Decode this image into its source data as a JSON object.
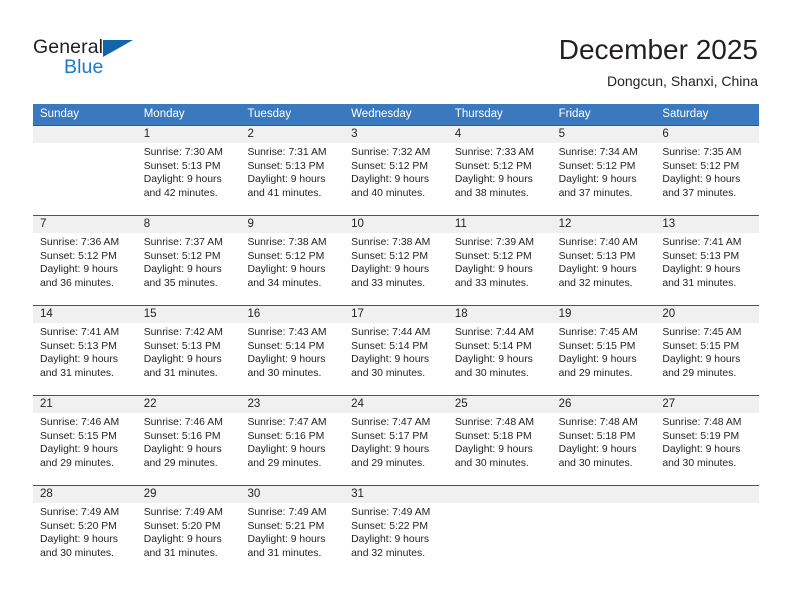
{
  "brand": {
    "name_top": "General",
    "name_bottom": "Blue",
    "accent_color": "#1c7ac6",
    "triangle_color": "#1464aa"
  },
  "header": {
    "title": "December 2025",
    "subtitle": "Dongcun, Shanxi, China"
  },
  "theme": {
    "header_row_bg": "#3a79bd",
    "header_row_text": "#ffffff",
    "week_separator": "#1f5fa0",
    "daynum_band_bg": "#f0f0f0",
    "text_color": "#231f20"
  },
  "weekdays": [
    "Sunday",
    "Monday",
    "Tuesday",
    "Wednesday",
    "Thursday",
    "Friday",
    "Saturday"
  ],
  "weeks": [
    {
      "days": [
        {
          "num": "",
          "sunrise": "",
          "sunset": "",
          "daylight_1": "",
          "daylight_2": "",
          "empty": true
        },
        {
          "num": "1",
          "sunrise": "Sunrise: 7:30 AM",
          "sunset": "Sunset: 5:13 PM",
          "daylight_1": "Daylight: 9 hours",
          "daylight_2": "and 42 minutes."
        },
        {
          "num": "2",
          "sunrise": "Sunrise: 7:31 AM",
          "sunset": "Sunset: 5:13 PM",
          "daylight_1": "Daylight: 9 hours",
          "daylight_2": "and 41 minutes."
        },
        {
          "num": "3",
          "sunrise": "Sunrise: 7:32 AM",
          "sunset": "Sunset: 5:12 PM",
          "daylight_1": "Daylight: 9 hours",
          "daylight_2": "and 40 minutes."
        },
        {
          "num": "4",
          "sunrise": "Sunrise: 7:33 AM",
          "sunset": "Sunset: 5:12 PM",
          "daylight_1": "Daylight: 9 hours",
          "daylight_2": "and 38 minutes."
        },
        {
          "num": "5",
          "sunrise": "Sunrise: 7:34 AM",
          "sunset": "Sunset: 5:12 PM",
          "daylight_1": "Daylight: 9 hours",
          "daylight_2": "and 37 minutes."
        },
        {
          "num": "6",
          "sunrise": "Sunrise: 7:35 AM",
          "sunset": "Sunset: 5:12 PM",
          "daylight_1": "Daylight: 9 hours",
          "daylight_2": "and 37 minutes."
        }
      ]
    },
    {
      "days": [
        {
          "num": "7",
          "sunrise": "Sunrise: 7:36 AM",
          "sunset": "Sunset: 5:12 PM",
          "daylight_1": "Daylight: 9 hours",
          "daylight_2": "and 36 minutes."
        },
        {
          "num": "8",
          "sunrise": "Sunrise: 7:37 AM",
          "sunset": "Sunset: 5:12 PM",
          "daylight_1": "Daylight: 9 hours",
          "daylight_2": "and 35 minutes."
        },
        {
          "num": "9",
          "sunrise": "Sunrise: 7:38 AM",
          "sunset": "Sunset: 5:12 PM",
          "daylight_1": "Daylight: 9 hours",
          "daylight_2": "and 34 minutes."
        },
        {
          "num": "10",
          "sunrise": "Sunrise: 7:38 AM",
          "sunset": "Sunset: 5:12 PM",
          "daylight_1": "Daylight: 9 hours",
          "daylight_2": "and 33 minutes."
        },
        {
          "num": "11",
          "sunrise": "Sunrise: 7:39 AM",
          "sunset": "Sunset: 5:12 PM",
          "daylight_1": "Daylight: 9 hours",
          "daylight_2": "and 33 minutes."
        },
        {
          "num": "12",
          "sunrise": "Sunrise: 7:40 AM",
          "sunset": "Sunset: 5:13 PM",
          "daylight_1": "Daylight: 9 hours",
          "daylight_2": "and 32 minutes."
        },
        {
          "num": "13",
          "sunrise": "Sunrise: 7:41 AM",
          "sunset": "Sunset: 5:13 PM",
          "daylight_1": "Daylight: 9 hours",
          "daylight_2": "and 31 minutes."
        }
      ]
    },
    {
      "days": [
        {
          "num": "14",
          "sunrise": "Sunrise: 7:41 AM",
          "sunset": "Sunset: 5:13 PM",
          "daylight_1": "Daylight: 9 hours",
          "daylight_2": "and 31 minutes."
        },
        {
          "num": "15",
          "sunrise": "Sunrise: 7:42 AM",
          "sunset": "Sunset: 5:13 PM",
          "daylight_1": "Daylight: 9 hours",
          "daylight_2": "and 31 minutes."
        },
        {
          "num": "16",
          "sunrise": "Sunrise: 7:43 AM",
          "sunset": "Sunset: 5:14 PM",
          "daylight_1": "Daylight: 9 hours",
          "daylight_2": "and 30 minutes."
        },
        {
          "num": "17",
          "sunrise": "Sunrise: 7:44 AM",
          "sunset": "Sunset: 5:14 PM",
          "daylight_1": "Daylight: 9 hours",
          "daylight_2": "and 30 minutes."
        },
        {
          "num": "18",
          "sunrise": "Sunrise: 7:44 AM",
          "sunset": "Sunset: 5:14 PM",
          "daylight_1": "Daylight: 9 hours",
          "daylight_2": "and 30 minutes."
        },
        {
          "num": "19",
          "sunrise": "Sunrise: 7:45 AM",
          "sunset": "Sunset: 5:15 PM",
          "daylight_1": "Daylight: 9 hours",
          "daylight_2": "and 29 minutes."
        },
        {
          "num": "20",
          "sunrise": "Sunrise: 7:45 AM",
          "sunset": "Sunset: 5:15 PM",
          "daylight_1": "Daylight: 9 hours",
          "daylight_2": "and 29 minutes."
        }
      ]
    },
    {
      "days": [
        {
          "num": "21",
          "sunrise": "Sunrise: 7:46 AM",
          "sunset": "Sunset: 5:15 PM",
          "daylight_1": "Daylight: 9 hours",
          "daylight_2": "and 29 minutes."
        },
        {
          "num": "22",
          "sunrise": "Sunrise: 7:46 AM",
          "sunset": "Sunset: 5:16 PM",
          "daylight_1": "Daylight: 9 hours",
          "daylight_2": "and 29 minutes."
        },
        {
          "num": "23",
          "sunrise": "Sunrise: 7:47 AM",
          "sunset": "Sunset: 5:16 PM",
          "daylight_1": "Daylight: 9 hours",
          "daylight_2": "and 29 minutes."
        },
        {
          "num": "24",
          "sunrise": "Sunrise: 7:47 AM",
          "sunset": "Sunset: 5:17 PM",
          "daylight_1": "Daylight: 9 hours",
          "daylight_2": "and 29 minutes."
        },
        {
          "num": "25",
          "sunrise": "Sunrise: 7:48 AM",
          "sunset": "Sunset: 5:18 PM",
          "daylight_1": "Daylight: 9 hours",
          "daylight_2": "and 30 minutes."
        },
        {
          "num": "26",
          "sunrise": "Sunrise: 7:48 AM",
          "sunset": "Sunset: 5:18 PM",
          "daylight_1": "Daylight: 9 hours",
          "daylight_2": "and 30 minutes."
        },
        {
          "num": "27",
          "sunrise": "Sunrise: 7:48 AM",
          "sunset": "Sunset: 5:19 PM",
          "daylight_1": "Daylight: 9 hours",
          "daylight_2": "and 30 minutes."
        }
      ]
    },
    {
      "days": [
        {
          "num": "28",
          "sunrise": "Sunrise: 7:49 AM",
          "sunset": "Sunset: 5:20 PM",
          "daylight_1": "Daylight: 9 hours",
          "daylight_2": "and 30 minutes."
        },
        {
          "num": "29",
          "sunrise": "Sunrise: 7:49 AM",
          "sunset": "Sunset: 5:20 PM",
          "daylight_1": "Daylight: 9 hours",
          "daylight_2": "and 31 minutes."
        },
        {
          "num": "30",
          "sunrise": "Sunrise: 7:49 AM",
          "sunset": "Sunset: 5:21 PM",
          "daylight_1": "Daylight: 9 hours",
          "daylight_2": "and 31 minutes."
        },
        {
          "num": "31",
          "sunrise": "Sunrise: 7:49 AM",
          "sunset": "Sunset: 5:22 PM",
          "daylight_1": "Daylight: 9 hours",
          "daylight_2": "and 32 minutes."
        },
        {
          "num": "",
          "sunrise": "",
          "sunset": "",
          "daylight_1": "",
          "daylight_2": "",
          "empty": true
        },
        {
          "num": "",
          "sunrise": "",
          "sunset": "",
          "daylight_1": "",
          "daylight_2": "",
          "empty": true
        },
        {
          "num": "",
          "sunrise": "",
          "sunset": "",
          "daylight_1": "",
          "daylight_2": "",
          "empty": true
        }
      ]
    }
  ]
}
